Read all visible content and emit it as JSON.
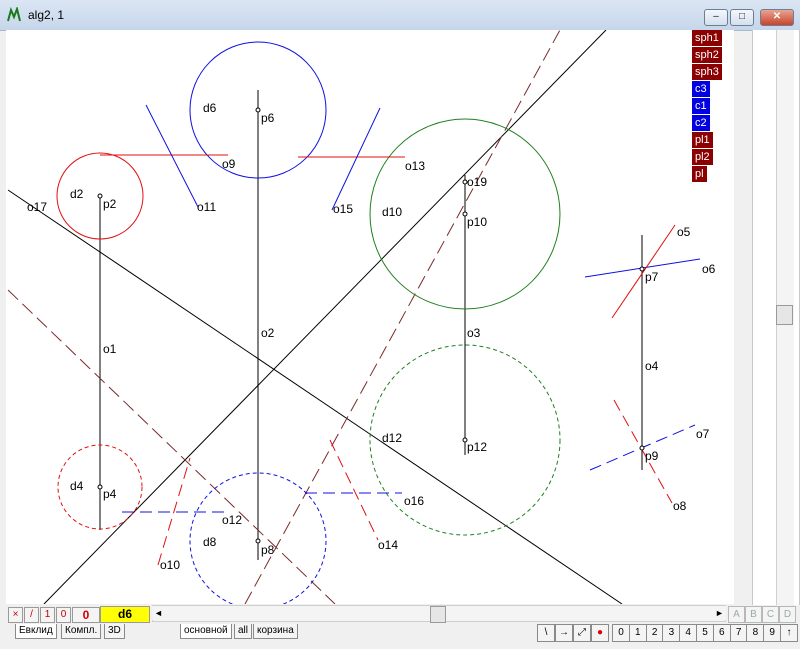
{
  "window": {
    "title": "alg2, 1",
    "min": "–",
    "max": "□",
    "close": "✕"
  },
  "legend": [
    {
      "label": "sph1",
      "color": "#8b0000"
    },
    {
      "label": "sph2",
      "color": "#8b0000"
    },
    {
      "label": "sph3",
      "color": "#8b0000"
    },
    {
      "label": "c3",
      "color": "#0000e0"
    },
    {
      "label": "c1",
      "color": "#0000e0"
    },
    {
      "label": "c2",
      "color": "#0000e0"
    },
    {
      "label": "pl1",
      "color": "#8b0000"
    },
    {
      "label": "pl2",
      "color": "#8b0000"
    },
    {
      "label": "pl",
      "color": "#8b0000"
    }
  ],
  "labels": {
    "d6": "d6",
    "p6": "p6",
    "o9": "o9",
    "o11": "o11",
    "o13": "o13",
    "o15": "o15",
    "d10": "d10",
    "o19": "o19",
    "p10": "p10",
    "d2": "d2",
    "p2": "p2",
    "o17": "o17",
    "o1": "o1",
    "o2": "o2",
    "o3": "o3",
    "d4": "d4",
    "p4": "p4",
    "o12": "o12",
    "d8": "d8",
    "p8": "p8",
    "o10": "o10",
    "o14": "o14",
    "o16": "o16",
    "d12": "d12",
    "p12": "p12",
    "o5": "o5",
    "o6": "o6",
    "p7": "p7",
    "o4": "o4",
    "o7": "o7",
    "p9": "p9",
    "o8": "o8"
  },
  "toolbar": {
    "x": "×",
    "slash": "/",
    "one": "1",
    "zero_small": "0",
    "zero": "0",
    "current": "d6"
  },
  "scroll": {
    "left": "◄",
    "right": "►",
    "up": "▲",
    "down": "▼"
  },
  "abcd": [
    "A",
    "B",
    "C",
    "D"
  ],
  "tabs": [
    {
      "label": "Евклид",
      "active": true
    },
    {
      "label": "Компл.",
      "active": false
    },
    {
      "label": "3D",
      "active": false
    },
    {
      "label": "основной",
      "active": true
    },
    {
      "label": "all",
      "active": false
    },
    {
      "label": "корзина",
      "active": false
    }
  ],
  "nav_buttons": [
    "\\",
    "→",
    "⤢",
    "●"
  ],
  "numbers": [
    "0",
    "1",
    "2",
    "3",
    "4",
    "5",
    "6",
    "7",
    "8",
    "9",
    "↑"
  ]
}
